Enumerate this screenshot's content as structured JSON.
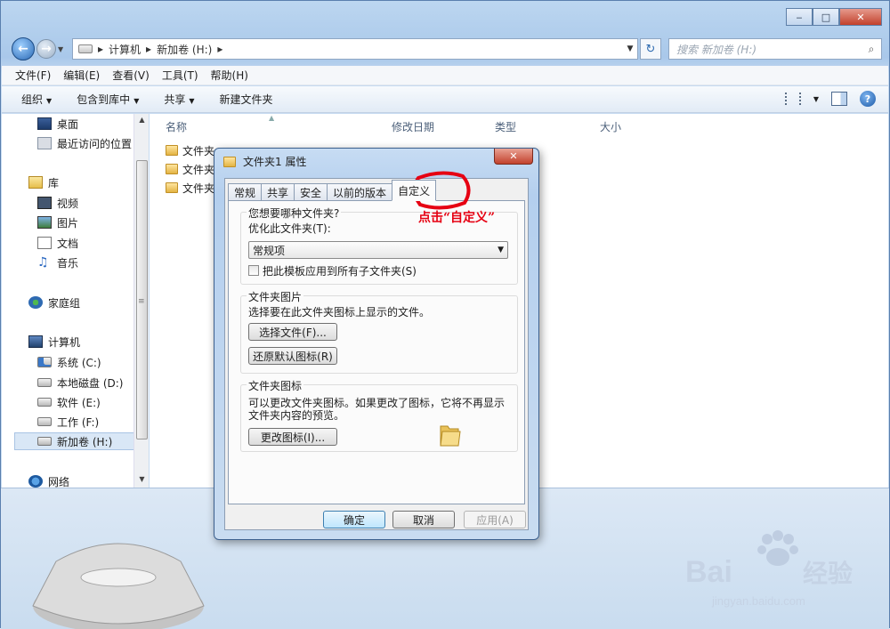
{
  "window": {
    "caption_buttons": [
      "minimize",
      "maximize",
      "close"
    ]
  },
  "address_bar": {
    "segments": [
      "计算机",
      "新加卷 (H:)"
    ]
  },
  "search": {
    "placeholder": "搜索 新加卷 (H:)"
  },
  "menu": [
    "文件(F)",
    "编辑(E)",
    "查看(V)",
    "工具(T)",
    "帮助(H)"
  ],
  "toolbar": {
    "organize": "组织",
    "include_library": "包含到库中",
    "share": "共享",
    "new_folder": "新建文件夹"
  },
  "nav_pane": {
    "items": [
      {
        "label": "桌面",
        "icon": "desktop-icon"
      },
      {
        "label": "最近访问的位置",
        "icon": "recent-places-icon"
      },
      {
        "label": "库",
        "icon": "library-icon"
      },
      {
        "label": "视频",
        "icon": "video-icon"
      },
      {
        "label": "图片",
        "icon": "pictures-icon"
      },
      {
        "label": "文档",
        "icon": "documents-icon"
      },
      {
        "label": "音乐",
        "icon": "music-icon"
      },
      {
        "label": "家庭组",
        "icon": "homegroup-icon"
      },
      {
        "label": "计算机",
        "icon": "computer-icon"
      },
      {
        "label": "系统 (C:)",
        "icon": "system-drive-icon"
      },
      {
        "label": "本地磁盘 (D:)",
        "icon": "drive-icon"
      },
      {
        "label": "软件 (E:)",
        "icon": "drive-icon"
      },
      {
        "label": "工作 (F:)",
        "icon": "drive-icon"
      },
      {
        "label": "新加卷 (H:)",
        "icon": "drive-icon",
        "selected": true
      },
      {
        "label": "网络",
        "icon": "network-icon"
      }
    ]
  },
  "file_list": {
    "columns": [
      "名称",
      "修改日期",
      "类型",
      "大小"
    ],
    "rows": [
      "文件夹",
      "文件夹",
      "文件夹"
    ]
  },
  "dialog": {
    "title": "文件夹1 属性",
    "tabs": [
      "常规",
      "共享",
      "安全",
      "以前的版本",
      "自定义"
    ],
    "active_tab": "自定义",
    "section1": {
      "title": "您想要哪种文件夹?",
      "optimize_label": "优化此文件夹(T):",
      "optimize_value": "常规项",
      "apply_subfolders": "把此模板应用到所有子文件夹(S)"
    },
    "section2": {
      "title": "文件夹图片",
      "desc": "选择要在此文件夹图标上显示的文件。",
      "choose_file": "选择文件(F)...",
      "restore_default": "还原默认图标(R)"
    },
    "section3": {
      "title": "文件夹图标",
      "desc1": "可以更改文件夹图标。如果更改了图标，它将不再显示",
      "desc2": "文件夹内容的预览。",
      "change_icon": "更改图标(I)..."
    },
    "buttons": {
      "ok": "确定",
      "cancel": "取消",
      "apply": "应用(A)"
    }
  },
  "annotation": {
    "text": "点击“自定义”",
    "color": "#e60012"
  },
  "watermark": {
    "brand": "Bai du 经验",
    "url": "jingyan.baidu.com"
  }
}
